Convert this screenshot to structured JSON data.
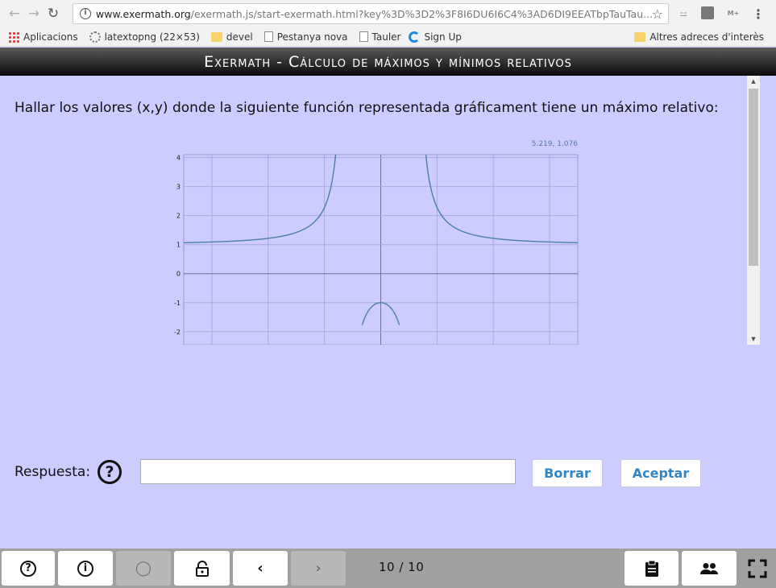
{
  "browser": {
    "url_host": "www.exermath.org",
    "url_path": "/exermath.js/start-exermath.html?key%3D%3D2%3F8I6DU6I6C4%3AD6DI9EEATbpTauTau...",
    "bookmarks": [
      {
        "label": "Aplicacions",
        "icon": "apps-grid-icon"
      },
      {
        "label": "latextopng (22×53)",
        "icon": "loading-icon"
      },
      {
        "label": "devel",
        "icon": "folder-icon"
      },
      {
        "label": "Pestanya nova",
        "icon": "page-icon"
      },
      {
        "label": "Tauler",
        "icon": "page-icon"
      },
      {
        "label": "Sign Up",
        "icon": "signup-icon"
      }
    ],
    "other_bookmarks": "Altres adreces d'interès",
    "ext_mplus": "M+"
  },
  "app": {
    "title": "Exermath - Cálculo de máximos y mínimos relativos"
  },
  "question": {
    "text": "Hallar los valores (x,y) donde la siguiente función representada gráficament tiene un máximo relativo:"
  },
  "chart_data": {
    "type": "line",
    "coord_label": "5.219, 1.076",
    "xlim": [
      -7,
      7
    ],
    "ylim": [
      -2.45,
      4.1
    ],
    "y_ticks": [
      4,
      3,
      2,
      1,
      0,
      -1,
      -2
    ],
    "x_grid": [
      -6,
      -4,
      -2,
      0,
      2,
      4,
      6
    ],
    "grid": true,
    "series": [
      {
        "color": "#4a7fa8",
        "function": "rational_vertical_asymptotes_at_x_-1.25_and_1.25"
      }
    ],
    "relative_maximum_visible": [
      0,
      -1
    ]
  },
  "answer": {
    "label": "Respuesta:",
    "help_symbol": "?",
    "value": "",
    "clear_label": "Borrar",
    "accept_label": "Aceptar"
  },
  "bottombar": {
    "counter": "10 / 10"
  }
}
